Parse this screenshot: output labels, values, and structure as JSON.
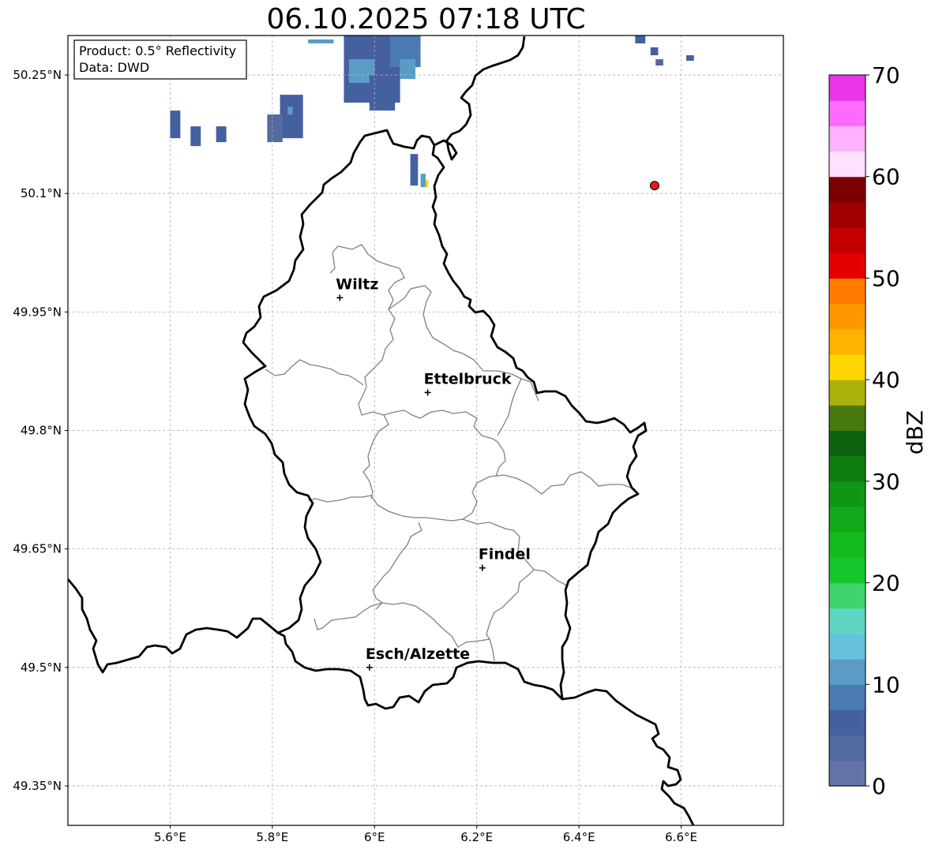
{
  "title": "06.10.2025 07:18 UTC",
  "info_box": {
    "line1": "Product: 0.5° Reflectivity",
    "line2": "Data: DWD"
  },
  "map": {
    "lon_range": [
      5.4,
      6.8
    ],
    "lat_range": [
      49.3,
      50.3
    ],
    "lon_ticks": [
      {
        "value": 5.6,
        "label": "5.6°E"
      },
      {
        "value": 5.8,
        "label": "5.8°E"
      },
      {
        "value": 6.0,
        "label": "6°E"
      },
      {
        "value": 6.2,
        "label": "6.2°E"
      },
      {
        "value": 6.4,
        "label": "6.4°E"
      },
      {
        "value": 6.6,
        "label": "6.6°E"
      }
    ],
    "lat_ticks": [
      {
        "value": 50.25,
        "label": "50.25°N"
      },
      {
        "value": 50.1,
        "label": "50.1°N"
      },
      {
        "value": 49.95,
        "label": "49.95°N"
      },
      {
        "value": 49.8,
        "label": "49.8°N"
      },
      {
        "value": 49.65,
        "label": "49.65°N"
      },
      {
        "value": 49.5,
        "label": "49.5°N"
      },
      {
        "value": 49.35,
        "label": "49.35°N"
      }
    ],
    "cities": [
      {
        "name": "Wiltz",
        "lon": 5.932,
        "lat": 49.968
      },
      {
        "name": "Ettelbruck",
        "lon": 6.104,
        "lat": 49.848
      },
      {
        "name": "Findel",
        "lon": 6.211,
        "lat": 49.626
      },
      {
        "name": "Esch/Alzette",
        "lon": 5.99,
        "lat": 49.5
      }
    ],
    "radar_site": {
      "lon": 6.548,
      "lat": 50.11,
      "color": "#e31a1c"
    },
    "colors": {
      "border": "#000000",
      "districts": "#808080",
      "grid": "#b0b0b0"
    }
  },
  "colorbar": {
    "label": "dBZ",
    "ticks": [
      "0",
      "10",
      "20",
      "30",
      "40",
      "50",
      "60",
      "70"
    ],
    "min": 0,
    "max": 70,
    "step": 2.5,
    "colors": [
      "#6473a6",
      "#536aa0",
      "#45609f",
      "#4a7bb2",
      "#5b9cc6",
      "#66c2dc",
      "#5fd6c4",
      "#3fd46c",
      "#14c82c",
      "#14bb1e",
      "#11a819",
      "#0f9614",
      "#0d7d11",
      "#0c6410",
      "#487a0d",
      "#acb20c",
      "#ffd700",
      "#ffb300",
      "#ff9800",
      "#ff7c00",
      "#e50000",
      "#c20000",
      "#a00000",
      "#7d0000",
      "#ffe0ff",
      "#ffb3ff",
      "#ff6bff",
      "#e935e9"
    ]
  },
  "precip_cells": [
    {
      "lon": 5.87,
      "lat": 50.29,
      "lon2": 5.92,
      "lat2": 50.295,
      "dbz": 12
    },
    {
      "lon": 5.94,
      "lat": 50.215,
      "lon2": 6.05,
      "lat2": 50.3,
      "dbz": 7
    },
    {
      "lon": 5.95,
      "lat": 50.24,
      "lon2": 6.0,
      "lat2": 50.27,
      "dbz": 11
    },
    {
      "lon": 5.99,
      "lat": 50.205,
      "lon2": 6.04,
      "lat2": 50.25,
      "dbz": 5
    },
    {
      "lon": 6.03,
      "lat": 50.26,
      "lon2": 6.09,
      "lat2": 50.3,
      "dbz": 8
    },
    {
      "lon": 6.05,
      "lat": 50.245,
      "lon2": 6.08,
      "lat2": 50.27,
      "dbz": 11
    },
    {
      "lon": 5.815,
      "lat": 50.17,
      "lon2": 5.86,
      "lat2": 50.225,
      "dbz": 6
    },
    {
      "lon": 5.79,
      "lat": 50.165,
      "lon2": 5.82,
      "lat2": 50.2,
      "dbz": 4
    },
    {
      "lon": 5.83,
      "lat": 50.2,
      "lon2": 5.84,
      "lat2": 50.21,
      "dbz": 11
    },
    {
      "lon": 5.6,
      "lat": 50.17,
      "lon2": 5.62,
      "lat2": 50.205,
      "dbz": 5
    },
    {
      "lon": 5.64,
      "lat": 50.16,
      "lon2": 5.66,
      "lat2": 50.185,
      "dbz": 5
    },
    {
      "lon": 5.69,
      "lat": 50.165,
      "lon2": 5.71,
      "lat2": 50.185,
      "dbz": 5
    },
    {
      "lon": 6.07,
      "lat": 50.11,
      "lon2": 6.085,
      "lat2": 50.15,
      "dbz": 5
    },
    {
      "lon": 6.09,
      "lat": 50.108,
      "lon2": 6.1,
      "lat2": 50.125,
      "dbz": 10
    },
    {
      "lon": 6.1,
      "lat": 50.108,
      "lon2": 6.105,
      "lat2": 50.117,
      "dbz": 42
    },
    {
      "lon": 6.51,
      "lat": 50.3,
      "lon2": 6.53,
      "lat2": 50.29,
      "dbz": 5
    },
    {
      "lon": 6.54,
      "lat": 50.275,
      "lon2": 6.555,
      "lat2": 50.285,
      "dbz": 5
    },
    {
      "lon": 6.55,
      "lat": 50.262,
      "lon2": 6.565,
      "lat2": 50.27,
      "dbz": 4
    },
    {
      "lon": 6.61,
      "lat": 50.268,
      "lon2": 6.625,
      "lat2": 50.275,
      "dbz": 5
    }
  ]
}
